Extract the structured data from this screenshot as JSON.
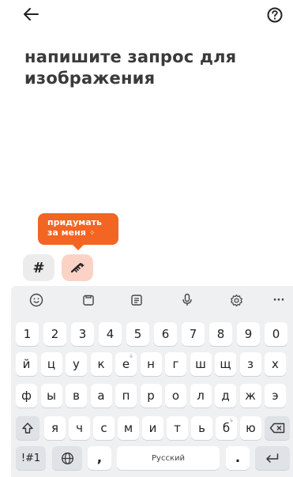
{
  "header": {
    "back_icon": "arrow-left-icon",
    "help_icon": "help-circle-icon"
  },
  "title": "напишите запрос для изображения",
  "suggest": {
    "text": "придумать за меня",
    "icon": "magic-wand-icon"
  },
  "chips": {
    "hash": "#",
    "magic_icon": "magic-wand-icon"
  },
  "colors": {
    "accent": "#f26522",
    "chip_accent": "#fbd3c6"
  },
  "keyboard": {
    "toolbar_icons": [
      "emoji-icon",
      "clipboard-icon",
      "sticker-icon",
      "microphone-icon",
      "settings-icon",
      "more-icon"
    ],
    "more_label": "···",
    "digits": [
      "1",
      "2",
      "3",
      "4",
      "5",
      "6",
      "7",
      "8",
      "9",
      "0"
    ],
    "row1": [
      "й",
      "ц",
      "у",
      "к",
      "е",
      "н",
      "г",
      "ш",
      "щ",
      "з",
      "х"
    ],
    "row1_sub_e": "ё",
    "row2": [
      "ф",
      "ы",
      "в",
      "а",
      "п",
      "р",
      "о",
      "л",
      "д",
      "ж",
      "э"
    ],
    "row3": [
      "я",
      "ч",
      "с",
      "м",
      "и",
      "т",
      "ь",
      "б",
      "ю"
    ],
    "row3_sub_b": "ъ",
    "symbols_label": "!#1",
    "comma": ",",
    "space_label": "Русский",
    "period": "."
  }
}
